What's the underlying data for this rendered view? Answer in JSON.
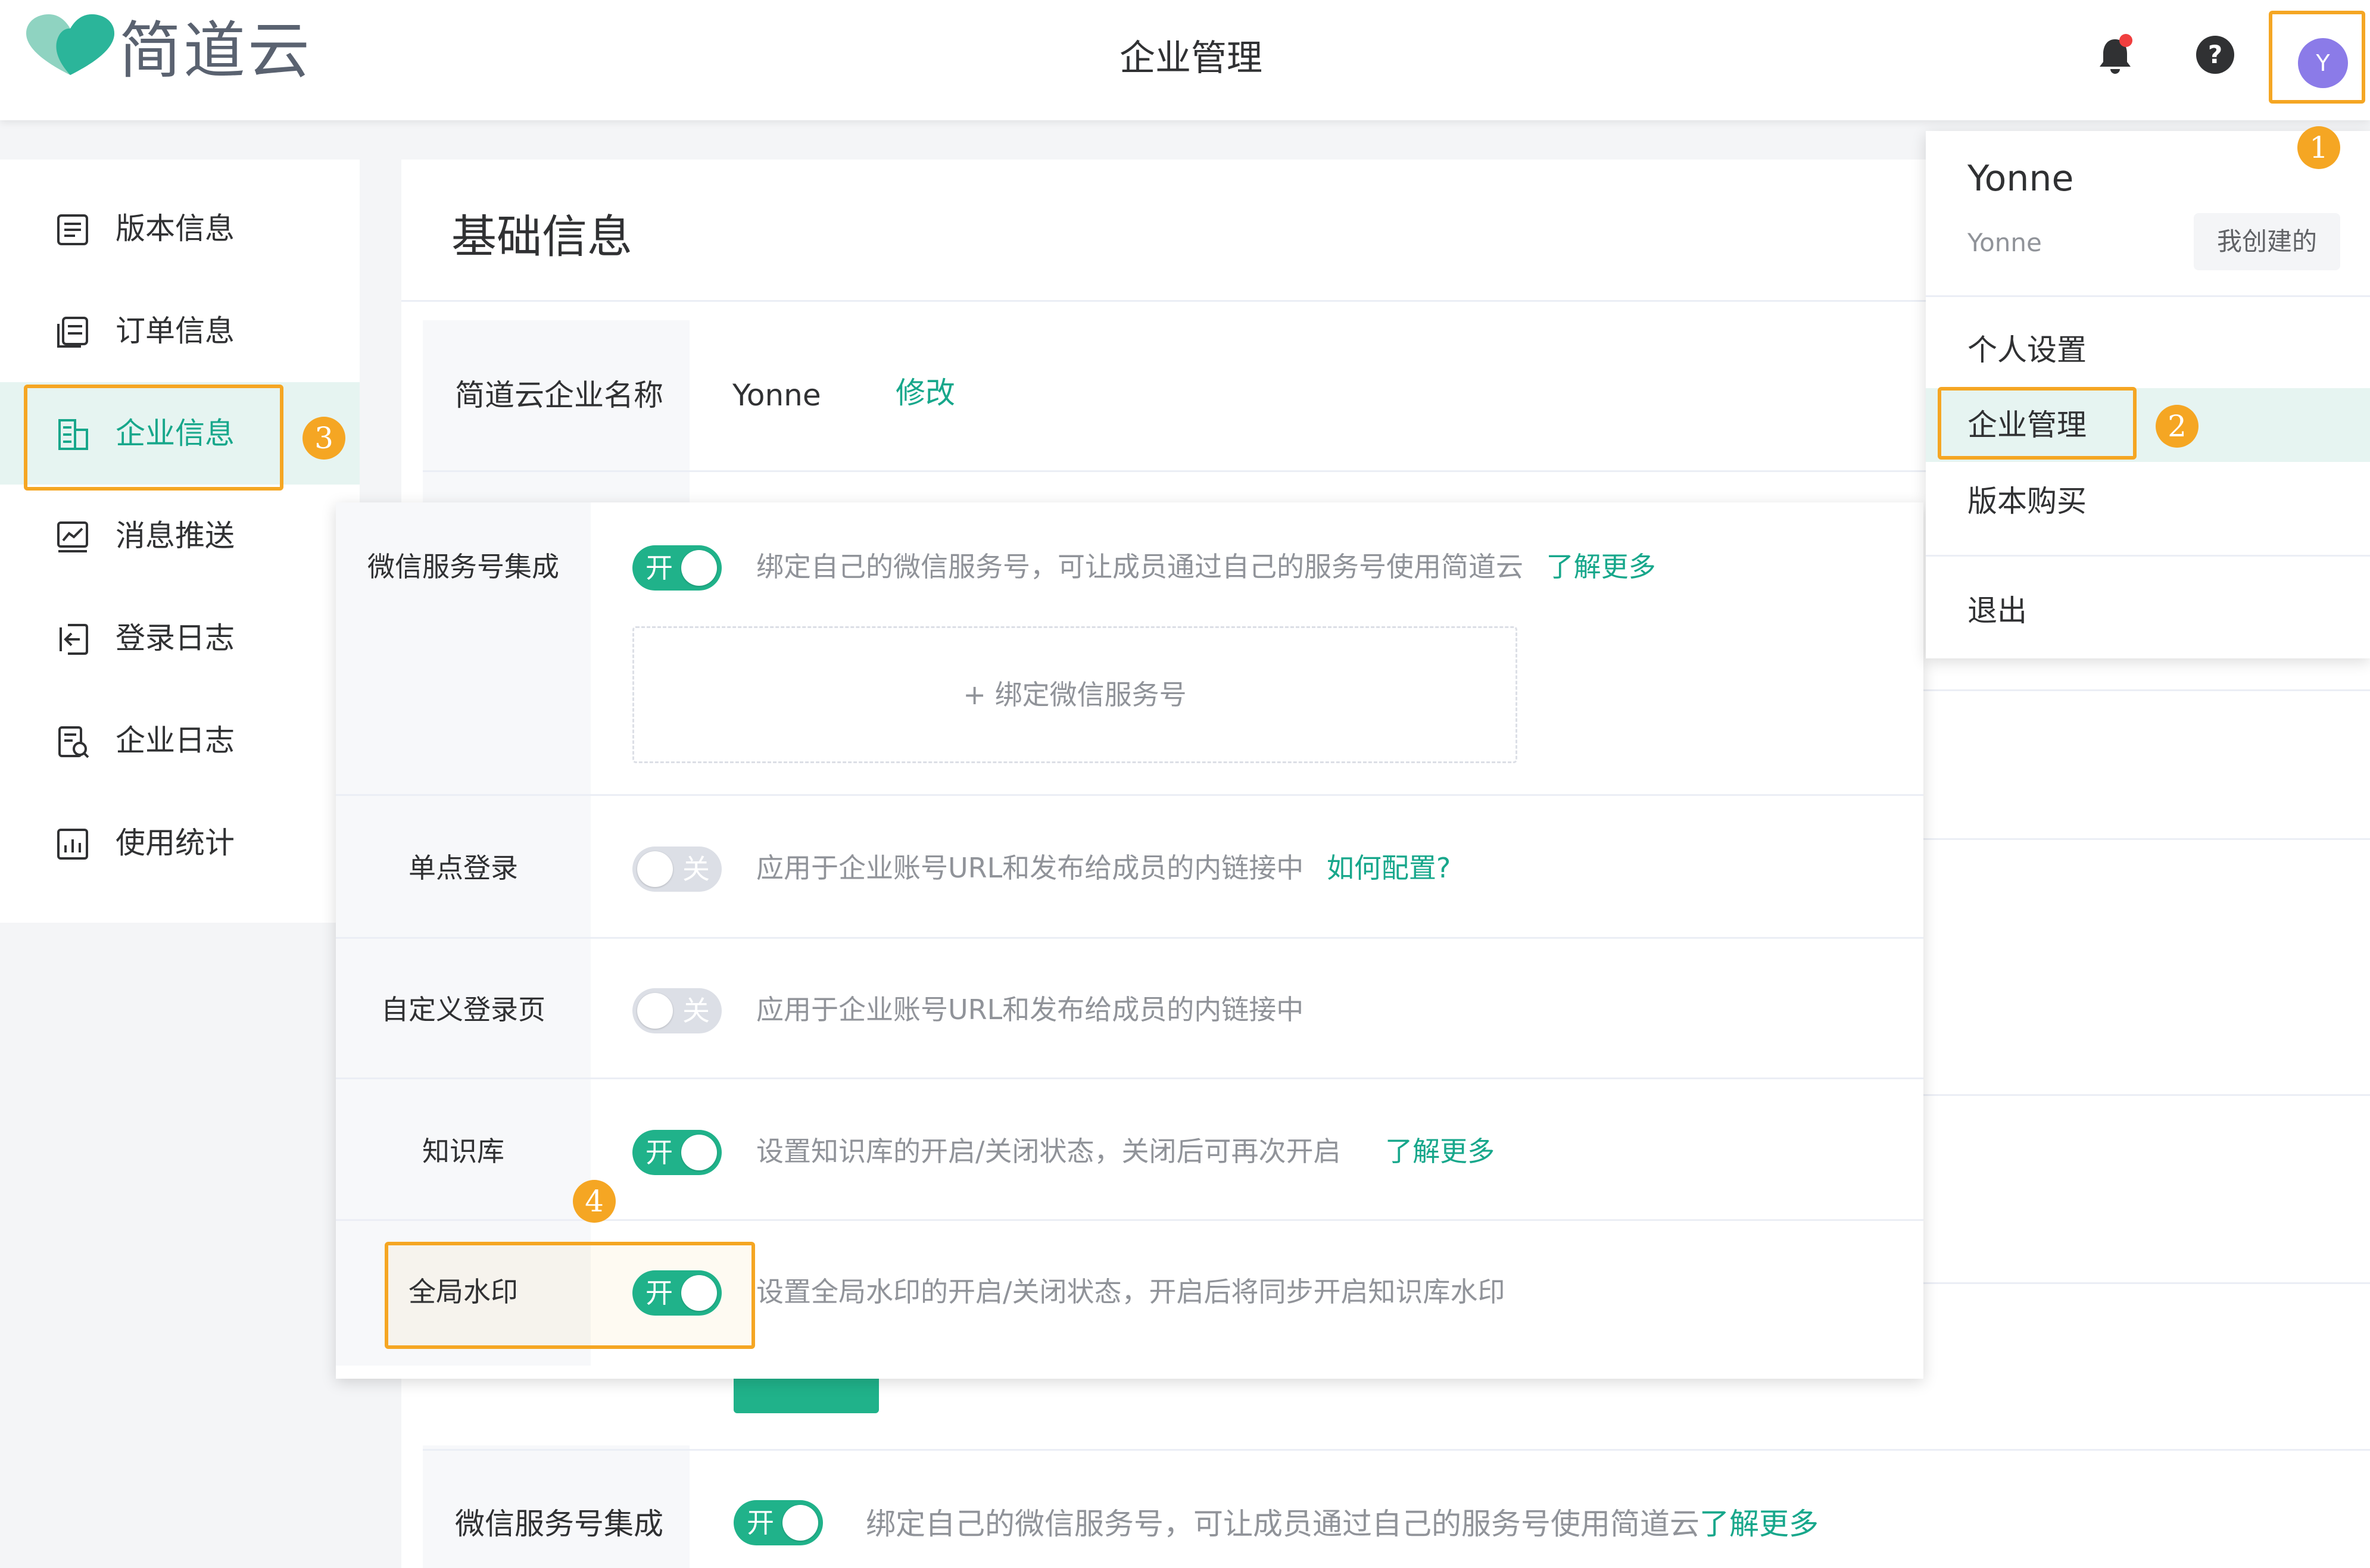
{
  "header": {
    "logo_text": "简道云",
    "page_title": "企业管理",
    "avatar_initial": "Y"
  },
  "badges": [
    "1",
    "2",
    "3",
    "4"
  ],
  "sidebar": {
    "items": [
      {
        "label": "版本信息",
        "icon": "document-icon"
      },
      {
        "label": "订单信息",
        "icon": "order-icon"
      },
      {
        "label": "企业信息",
        "icon": "building-icon"
      },
      {
        "label": "消息推送",
        "icon": "chart-icon"
      },
      {
        "label": "登录日志",
        "icon": "login-icon"
      },
      {
        "label": "企业日志",
        "icon": "log-icon"
      },
      {
        "label": "使用统计",
        "icon": "stats-icon"
      }
    ],
    "active_index": 2
  },
  "main": {
    "section_title": "基础信息",
    "name_label": "简道云企业名称",
    "name_value": "Yonne",
    "edit_link": "修改",
    "bottom_label": "微信服务号集成",
    "bottom_switch": "开",
    "bottom_desc": "绑定自己的微信服务号，可让成员通过自己的服务号使用简道云",
    "bottom_link": "了解更多"
  },
  "panel": {
    "rows": [
      {
        "label": "微信服务号集成",
        "state": "开",
        "desc": "绑定自己的微信服务号，可让成员通过自己的服务号使用简道云",
        "link": "了解更多"
      },
      {
        "label": "单点登录",
        "state": "关",
        "desc": "应用于企业账号URL和发布给成员的内链接中",
        "link": "如何配置?"
      },
      {
        "label": "自定义登录页",
        "state": "关",
        "desc": "应用于企业账号URL和发布给成员的内链接中",
        "link": ""
      },
      {
        "label": "知识库",
        "state": "开",
        "desc": "设置知识库的开启/关闭状态，关闭后可再次开启",
        "link": "了解更多"
      },
      {
        "label": "全局水印",
        "state": "开",
        "desc": "设置全局水印的开启/关闭状态，开启后将同步开启知识库水印",
        "link": ""
      }
    ],
    "bind_button": "绑定微信服务号",
    "bind_plus": "+"
  },
  "dropdown": {
    "user_name": "Yonne",
    "user_sub": "Yonne",
    "tag": "我创建的",
    "items": [
      "个人设置",
      "企业管理",
      "版本购买",
      "退出"
    ]
  },
  "colors": {
    "brand_green": "#17a78b",
    "switch_on": "#20b28a",
    "switch_off": "#dcdfe6",
    "highlight": "#f5a623",
    "avatar": "#8b7be8",
    "notify_dot": "#f03e3e"
  }
}
